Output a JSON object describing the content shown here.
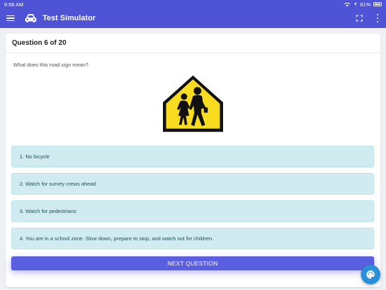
{
  "status_bar": {
    "time": "6:58 AM",
    "battery": "81%"
  },
  "app_bar": {
    "title": "Test Simulator"
  },
  "question": {
    "header": "Question 6 of 20",
    "prompt": "What does this road sign mean?",
    "sign_icon": "school-crossing-sign-icon"
  },
  "answers": [
    "1. No bicycle",
    "2. Watch for survey crews ahead",
    "3. Watch for pedestrians",
    "4. You are in a school zone. Slow down, prepare to stop, and watch out for children."
  ],
  "next_button": {
    "label": "NEXT QUESTION"
  },
  "colors": {
    "primary": "#4f53d6",
    "answer_bg": "#d1ecf1",
    "sign_yellow": "#f9dc1f",
    "fab": "#2a8fd6"
  }
}
